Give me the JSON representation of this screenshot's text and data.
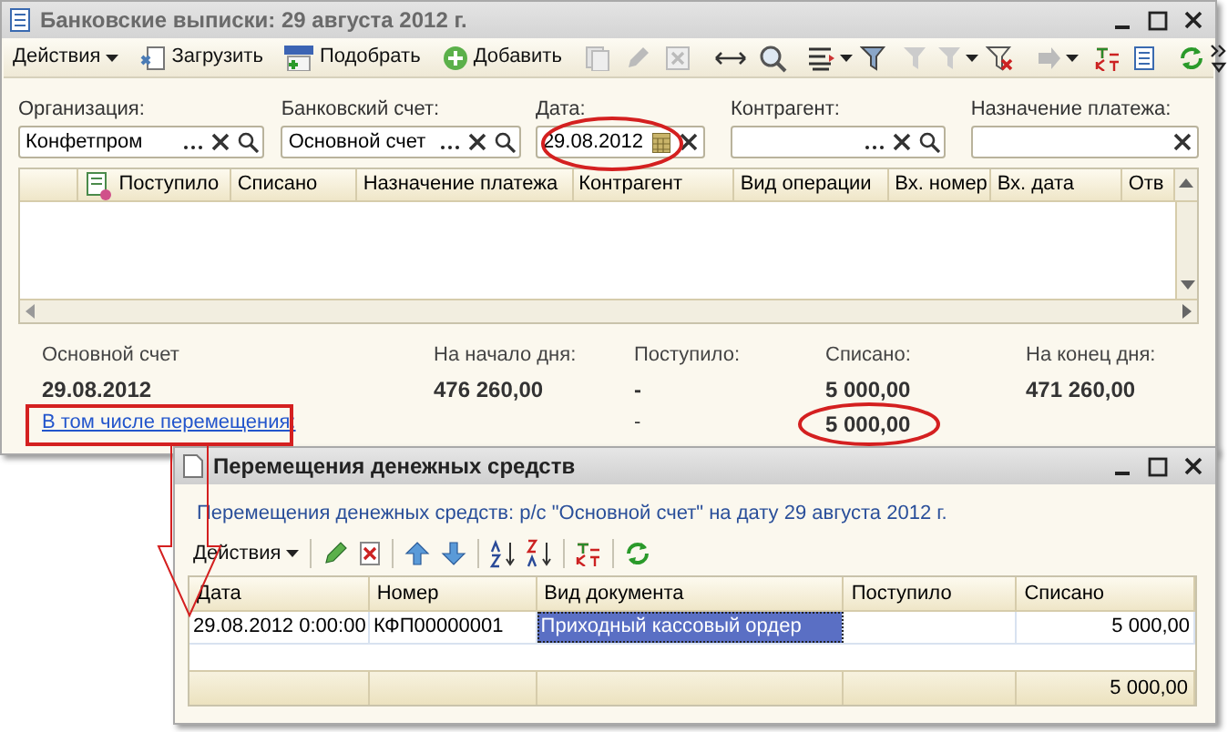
{
  "main_window": {
    "title": "Банковские выписки: 29 августа 2012 г.",
    "toolbar": [
      {
        "label": "Действия",
        "kind": "menu"
      },
      {
        "label": "Загрузить",
        "kind": "load"
      },
      {
        "label": "Подобрать",
        "kind": "pick"
      },
      {
        "label": "Добавить",
        "kind": "add"
      }
    ],
    "filters": [
      {
        "label": "Организация:",
        "value": "Конфетпром",
        "kind": "full"
      },
      {
        "label": "Банковский счет:",
        "value": "Основной счет",
        "kind": "full"
      },
      {
        "label": "Дата:",
        "value": "29.08.2012",
        "kind": "date"
      },
      {
        "label": "Контрагент:",
        "kind": "full"
      },
      {
        "label": "Назначение платежа:",
        "kind": "clear"
      }
    ],
    "table": {
      "columns": [
        "Поступило",
        "Списано",
        "Назначение платежа",
        "Контрагент",
        "Вид операции",
        "Вх. номер",
        "Вх. дата",
        "Отв"
      ]
    },
    "summary": [
      {
        "label": "Основной счет",
        "value": "29.08.2012"
      },
      {
        "label": "На начало дня:",
        "value": "476 260,00"
      },
      {
        "label": "Поступило:",
        "value": "-",
        "moves": "-"
      },
      {
        "label": "Списано:",
        "value": "5 000,00",
        "moves": "5 000,00"
      },
      {
        "label": "На конец дня:",
        "value": "471 260,00"
      }
    ],
    "moves_link": "В том числе перемещения:"
  },
  "moves_window": {
    "title": "Перемещения денежных средств",
    "subtitle": "Перемещения денежных средств: р/с \"Основной счет\" на дату 29 августа 2012 г.",
    "toolbar": [
      {
        "label": "Действия",
        "kind": "menu"
      }
    ],
    "table": {
      "columns": [
        "Дата",
        "Номер",
        "Вид документа",
        "Поступило",
        "Списано"
      ],
      "rows": [
        {
          "cells": [
            {
              "text": "29.08.2012 0:00:00",
              "selected": false
            },
            {
              "text": "КФП00000001",
              "selected": false
            },
            {
              "text": "Приходный кассовый ордер",
              "selected": true
            },
            {
              "selected": false
            },
            {
              "text": "5 000,00",
              "selected": false
            }
          ]
        }
      ],
      "total_written_off": "5 000,00"
    }
  }
}
